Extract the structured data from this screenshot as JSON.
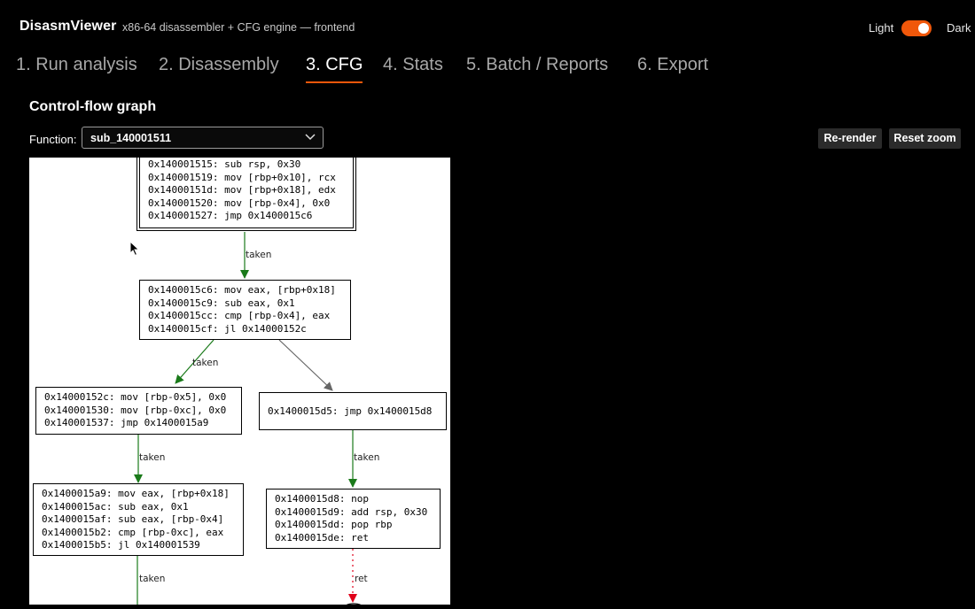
{
  "header": {
    "app_name": "DisasmViewer",
    "subtitle": "x86-64 disassembler + CFG engine — frontend",
    "theme_light_label": "Light",
    "theme_dark_label": "Dark",
    "theme_toggle_state": "dark"
  },
  "tabs": [
    {
      "label": "1. Run analysis",
      "active": false
    },
    {
      "label": "2. Disassembly",
      "active": false
    },
    {
      "label": "3. CFG",
      "active": true
    },
    {
      "label": "4. Stats",
      "active": false
    },
    {
      "label": "5. Batch / Reports",
      "active": false
    },
    {
      "label": "6. Export",
      "active": false
    }
  ],
  "cfg": {
    "title": "Control-flow graph",
    "function_label": "Function:",
    "function_value": "sub_140001511",
    "rerender_label": "Re-render",
    "reset_zoom_label": "Reset zoom",
    "blocks": [
      {
        "id": "b0",
        "lines": [
          "0x140001515: sub rsp, 0x30",
          "0x140001519: mov [rbp+0x10], rcx",
          "0x14000151d: mov [rbp+0x18], edx",
          "0x140001520: mov [rbp-0x4], 0x0",
          "0x140001527: jmp 0x1400015c6"
        ]
      },
      {
        "id": "b1",
        "lines": [
          "0x1400015c6: mov eax, [rbp+0x18]",
          "0x1400015c9: sub eax, 0x1",
          "0x1400015cc: cmp [rbp-0x4], eax",
          "0x1400015cf: jl 0x14000152c"
        ]
      },
      {
        "id": "b2",
        "lines": [
          "0x14000152c: mov [rbp-0x5], 0x0",
          "0x140001530: mov [rbp-0xc], 0x0",
          "0x140001537: jmp 0x1400015a9"
        ]
      },
      {
        "id": "b3",
        "lines": [
          "0x1400015d5: jmp 0x1400015d8"
        ]
      },
      {
        "id": "b4",
        "lines": [
          "0x1400015a9: mov eax, [rbp+0x18]",
          "0x1400015ac: sub eax, 0x1",
          "0x1400015af: sub eax, [rbp-0x4]",
          "0x1400015b2: cmp [rbp-0xc], eax",
          "0x1400015b5: jl 0x140001539"
        ]
      },
      {
        "id": "b5",
        "lines": [
          "0x1400015d8: nop",
          "0x1400015d9: add rsp, 0x30",
          "0x1400015dd: pop rbp",
          "0x1400015de: ret"
        ]
      }
    ],
    "edge_labels": [
      "taken",
      "taken",
      "taken",
      "taken",
      "taken",
      "ret"
    ],
    "colors": {
      "taken": "#1a7a1a",
      "fallthrough": "#666666",
      "ret": "#e0001a"
    }
  }
}
